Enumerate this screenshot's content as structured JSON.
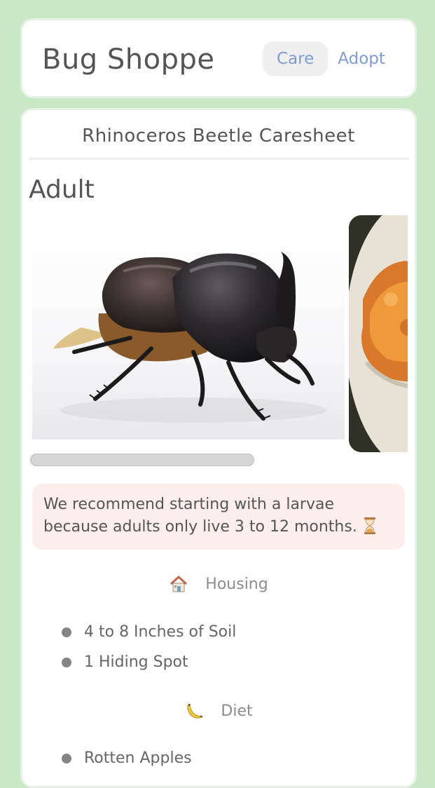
{
  "header": {
    "brand": "Bug Shoppe",
    "nav": [
      {
        "label": "Care",
        "active": true
      },
      {
        "label": "Adopt",
        "active": false
      }
    ]
  },
  "caresheet": {
    "title": "Rhinoceros Beetle Caresheet",
    "stage": "Adult",
    "gallery": {
      "images": [
        {
          "icon": "rhinoceros-beetle-photo"
        },
        {
          "icon": "beetle-jelly-food-photo"
        }
      ]
    },
    "notice": {
      "text": "We recommend starting with a larvae because adults only live 3 to 12 months.",
      "icon": "hourglass-icon",
      "background": "#fdeeee"
    },
    "sections": [
      {
        "icon": "house-icon",
        "title": "Housing",
        "items": [
          "4 to 8 Inches of Soil",
          "1 Hiding Spot"
        ]
      },
      {
        "icon": "banana-icon",
        "title": "Diet",
        "items": [
          "Rotten Apples"
        ]
      }
    ]
  },
  "colors": {
    "page_background": "#c9e8c5",
    "nav_link": "#7f9ad6",
    "text": "#555555"
  }
}
